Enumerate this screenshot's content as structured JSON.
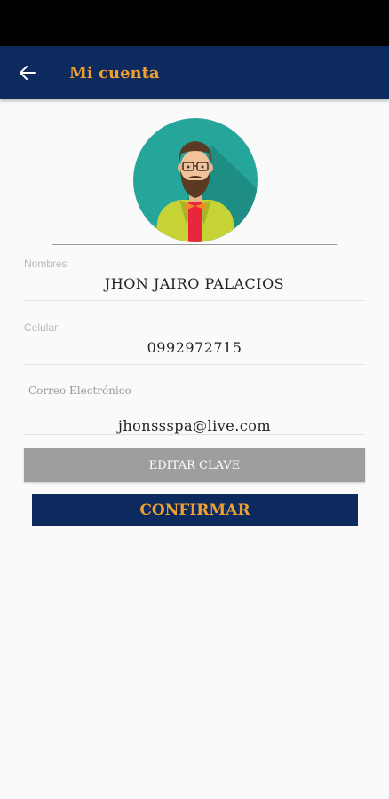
{
  "header": {
    "title": "Mi cuenta",
    "back_icon": "arrow-left-icon"
  },
  "profile": {
    "avatar_icon": "bearded-man-avatar-icon"
  },
  "fields": {
    "nombres": {
      "label": "Nombres",
      "value": "JHON JAIRO PALACIOS"
    },
    "celular": {
      "label": "Celular",
      "value": "0992972715"
    },
    "correo": {
      "label": "Correo Electrónico",
      "value": "jhonssspa@live.com"
    }
  },
  "buttons": {
    "editar_clave": "EDITAR CLAVE",
    "confirmar": "CONFIRMAR"
  },
  "colors": {
    "primary": "#0d2a5e",
    "accent": "#f0a030",
    "avatar_bg": "#26a69a",
    "secondary_button": "#9e9e9e"
  }
}
